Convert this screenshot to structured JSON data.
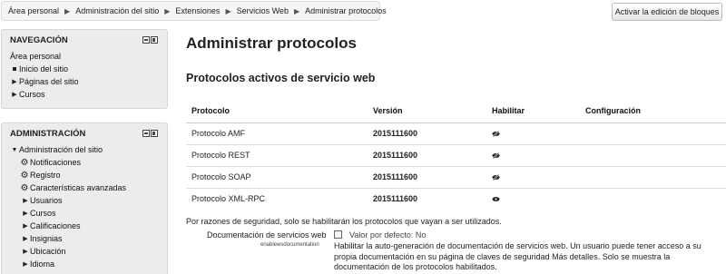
{
  "breadcrumb": [
    "Área personal",
    "Administración del sitio",
    "Extensiones",
    "Servicios Web",
    "Administrar protocolos"
  ],
  "block_edit_button": "Activar la edición de bloques",
  "navigation": {
    "title": "NAVEGACIÓN",
    "items": [
      {
        "label": "Área personal",
        "marker": "none"
      },
      {
        "label": "Inicio del sitio",
        "marker": "bullet"
      },
      {
        "label": "Páginas del sitio",
        "marker": "collapsed"
      },
      {
        "label": "Cursos",
        "marker": "collapsed"
      }
    ]
  },
  "administration": {
    "title": "ADMINISTRACIÓN",
    "root": "Administración del sitio",
    "gear_items": [
      "Notificaciones",
      "Registro",
      "Características avanzadas"
    ],
    "branch_items": [
      "Usuarios",
      "Cursos",
      "Calificaciones",
      "Insignias",
      "Ubicación",
      "Idioma"
    ]
  },
  "main": {
    "page_title": "Administrar protocolos",
    "section_title": "Protocolos activos de servicio web",
    "table": {
      "headers": [
        "Protocolo",
        "Versión",
        "Habilitar",
        "Configuración"
      ],
      "rows": [
        {
          "protocol": "Protocolo AMF",
          "version": "2015111600",
          "enabled": false
        },
        {
          "protocol": "Protocolo REST",
          "version": "2015111600",
          "enabled": false
        },
        {
          "protocol": "Protocolo SOAP",
          "version": "2015111600",
          "enabled": false
        },
        {
          "protocol": "Protocolo XML-RPC",
          "version": "2015111600",
          "enabled": true
        }
      ]
    },
    "security_note": "Por razones de seguridad, solo se habilitarán los protocolos que vayan a ser utilizados.",
    "documentation": {
      "label": "Documentación de servicios web",
      "sublabel": "enablewsdocumentation",
      "default_text": "Valor por defecto: No",
      "description": "Habilitar la auto-generación de documentación de servicios web. Un usuario puede tener acceso a su propia documentación en su página de claves de seguridad Más detalles. Solo se muestra la documentación de los protocolos habilitados."
    }
  }
}
